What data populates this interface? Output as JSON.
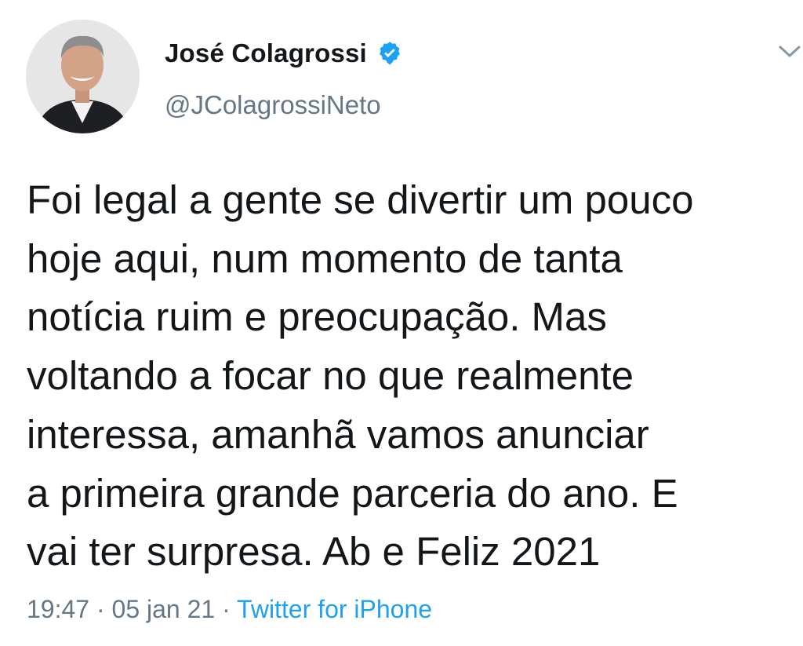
{
  "author": {
    "display_name": "José Colagrossi",
    "handle": "@JColagrossiNeto",
    "verified": true,
    "avatar_icon": "profile-photo"
  },
  "menu_icon": "chevron-down-icon",
  "tweet": {
    "lines": [
      "Foi legal a gente se divertir um pouco",
      "hoje aqui, num momento de tanta",
      "notícia ruim e preocupação. Mas",
      "voltando a focar no que realmente",
      "interessa, amanhã vamos anunciar",
      "a primeira grande parceria do ano. E",
      "vai ter surpresa. Ab e Feliz 2021"
    ]
  },
  "meta": {
    "time": "19:47",
    "separator1": " · ",
    "date": "05 jan 21",
    "separator2": " · ",
    "source": "Twitter for iPhone"
  },
  "colors": {
    "text": "#14171a",
    "secondary": "#657786",
    "link": "#1da1f2",
    "verified": "#1da1f2"
  }
}
